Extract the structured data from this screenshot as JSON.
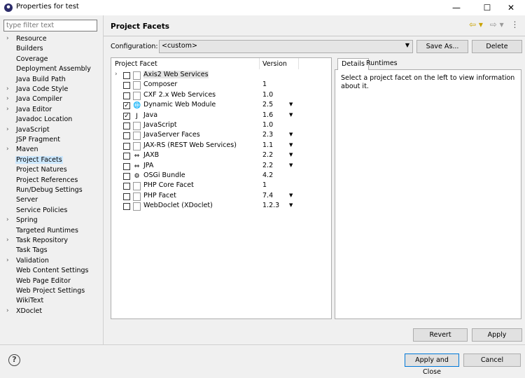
{
  "window": {
    "title": "Properties for test",
    "minimize": "—",
    "maximize": "☐",
    "close": "✕"
  },
  "filter": {
    "placeholder": "type filter text"
  },
  "sidebar": {
    "items": [
      {
        "label": "Resource",
        "expandable": true
      },
      {
        "label": "Builders",
        "expandable": false
      },
      {
        "label": "Coverage",
        "expandable": false
      },
      {
        "label": "Deployment Assembly",
        "expandable": false
      },
      {
        "label": "Java Build Path",
        "expandable": false
      },
      {
        "label": "Java Code Style",
        "expandable": true
      },
      {
        "label": "Java Compiler",
        "expandable": true
      },
      {
        "label": "Java Editor",
        "expandable": true
      },
      {
        "label": "Javadoc Location",
        "expandable": false
      },
      {
        "label": "JavaScript",
        "expandable": true
      },
      {
        "label": "JSP Fragment",
        "expandable": false
      },
      {
        "label": "Maven",
        "expandable": true
      },
      {
        "label": "Project Facets",
        "expandable": false,
        "selected": true
      },
      {
        "label": "Project Natures",
        "expandable": false
      },
      {
        "label": "Project References",
        "expandable": false
      },
      {
        "label": "Run/Debug Settings",
        "expandable": false
      },
      {
        "label": "Server",
        "expandable": false
      },
      {
        "label": "Service Policies",
        "expandable": false
      },
      {
        "label": "Spring",
        "expandable": true
      },
      {
        "label": "Targeted Runtimes",
        "expandable": false
      },
      {
        "label": "Task Repository",
        "expandable": true
      },
      {
        "label": "Task Tags",
        "expandable": false
      },
      {
        "label": "Validation",
        "expandable": true
      },
      {
        "label": "Web Content Settings",
        "expandable": false
      },
      {
        "label": "Web Page Editor",
        "expandable": false
      },
      {
        "label": "Web Project Settings",
        "expandable": false
      },
      {
        "label": "WikiText",
        "expandable": false
      },
      {
        "label": "XDoclet",
        "expandable": true
      }
    ]
  },
  "header": {
    "title": "Project Facets",
    "back_icon": "⇦ ▾",
    "forward_icon": "⇨ ▾",
    "menu_icon": "⋮"
  },
  "config": {
    "label": "Configuration:",
    "value": "<custom>",
    "save_as": "Save As...",
    "delete": "Delete"
  },
  "facets": {
    "col_facet": "Project Facet",
    "col_version": "Version",
    "rows": [
      {
        "name": "Axis2 Web Services",
        "version": "",
        "checked": false,
        "expandable": true,
        "dropdown": false,
        "icon": "document-icon",
        "glyph": ""
      },
      {
        "name": "Composer",
        "version": "1",
        "checked": false,
        "dropdown": false,
        "icon": "document-icon",
        "glyph": ""
      },
      {
        "name": "CXF 2.x Web Services",
        "version": "1.0",
        "checked": false,
        "dropdown": false,
        "icon": "document-icon",
        "glyph": ""
      },
      {
        "name": "Dynamic Web Module",
        "version": "2.5",
        "checked": true,
        "dropdown": true,
        "icon": "web-module-icon",
        "glyph": "🌐"
      },
      {
        "name": "Java",
        "version": "1.6",
        "checked": true,
        "dropdown": true,
        "icon": "java-icon",
        "glyph": "J"
      },
      {
        "name": "JavaScript",
        "version": "1.0",
        "checked": false,
        "dropdown": false,
        "icon": "document-icon",
        "glyph": ""
      },
      {
        "name": "JavaServer Faces",
        "version": "2.3",
        "checked": false,
        "dropdown": true,
        "icon": "document-icon",
        "glyph": ""
      },
      {
        "name": "JAX-RS (REST Web Services)",
        "version": "1.1",
        "checked": false,
        "dropdown": true,
        "icon": "document-icon",
        "glyph": ""
      },
      {
        "name": "JAXB",
        "version": "2.2",
        "checked": false,
        "dropdown": true,
        "icon": "jaxb-icon",
        "glyph": "⇔"
      },
      {
        "name": "JPA",
        "version": "2.2",
        "checked": false,
        "dropdown": true,
        "icon": "jpa-icon",
        "glyph": "⇔"
      },
      {
        "name": "OSGi Bundle",
        "version": "4.2",
        "checked": false,
        "dropdown": false,
        "icon": "osgi-icon",
        "glyph": "⚙"
      },
      {
        "name": "PHP Core Facet",
        "version": "1",
        "checked": false,
        "dropdown": false,
        "icon": "document-icon",
        "glyph": ""
      },
      {
        "name": "PHP Facet",
        "version": "7.4",
        "checked": false,
        "dropdown": true,
        "icon": "document-icon",
        "glyph": ""
      },
      {
        "name": "WebDoclet (XDoclet)",
        "version": "1.2.3",
        "checked": false,
        "dropdown": true,
        "icon": "document-icon",
        "glyph": ""
      }
    ]
  },
  "details": {
    "tab_details": "Details",
    "tab_runtimes": "Runtimes",
    "text": "Select a project facet on the left to view information about it."
  },
  "buttons": {
    "revert": "Revert",
    "apply": "Apply",
    "apply_close": "Apply and Close",
    "cancel": "Cancel",
    "help": "?"
  }
}
